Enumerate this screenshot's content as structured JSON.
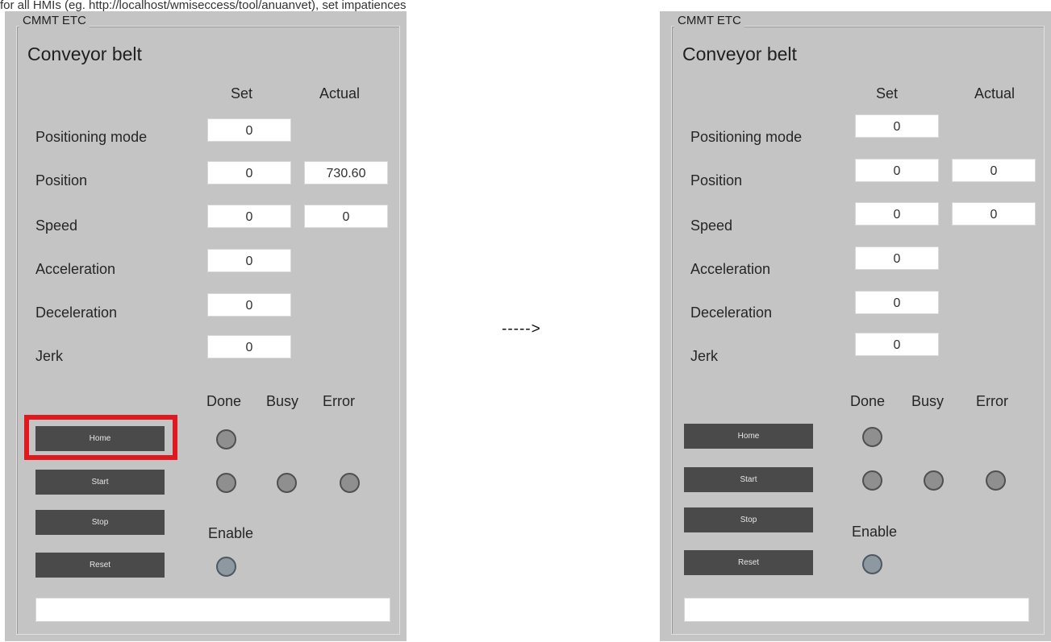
{
  "top_fragment": "for all HMIs (eg. http://localhost/wmiseccess/tool/anuanvet), set impatiences",
  "arrow": "----->",
  "left": {
    "group_title": "CMMT ETC",
    "title": "Conveyor belt",
    "col_set": "Set",
    "col_actual": "Actual",
    "rows": [
      {
        "label": "Positioning mode",
        "set": "0",
        "actual": null
      },
      {
        "label": "Position",
        "set": "0",
        "actual": "730.60"
      },
      {
        "label": "Speed",
        "set": "0",
        "actual": "0"
      },
      {
        "label": "Acceleration",
        "set": "0",
        "actual": null
      },
      {
        "label": "Deceleration",
        "set": "0",
        "actual": null
      },
      {
        "label": "Jerk",
        "set": "0",
        "actual": null
      }
    ],
    "status_headers": {
      "done": "Done",
      "busy": "Busy",
      "error": "Error"
    },
    "buttons": {
      "home": "Home",
      "start": "Start",
      "stop": "Stop",
      "reset": "Reset"
    },
    "enable_label": "Enable",
    "status_text": ""
  },
  "right": {
    "group_title": "CMMT ETC",
    "title": "Conveyor belt",
    "col_set": "Set",
    "col_actual": "Actual",
    "rows": [
      {
        "label": "Positioning mode",
        "set": "0",
        "actual": null
      },
      {
        "label": "Position",
        "set": "0",
        "actual": "0"
      },
      {
        "label": "Speed",
        "set": "0",
        "actual": "0"
      },
      {
        "label": "Acceleration",
        "set": "0",
        "actual": null
      },
      {
        "label": "Deceleration",
        "set": "0",
        "actual": null
      },
      {
        "label": "Jerk",
        "set": "0",
        "actual": null
      }
    ],
    "status_headers": {
      "done": "Done",
      "busy": "Busy",
      "error": "Error"
    },
    "buttons": {
      "home": "Home",
      "start": "Start",
      "stop": "Stop",
      "reset": "Reset"
    },
    "enable_label": "Enable",
    "status_text": ""
  },
  "colors": {
    "panel": "#c4c4c4",
    "button": "#4a4a4a",
    "highlight": "#e01820"
  }
}
